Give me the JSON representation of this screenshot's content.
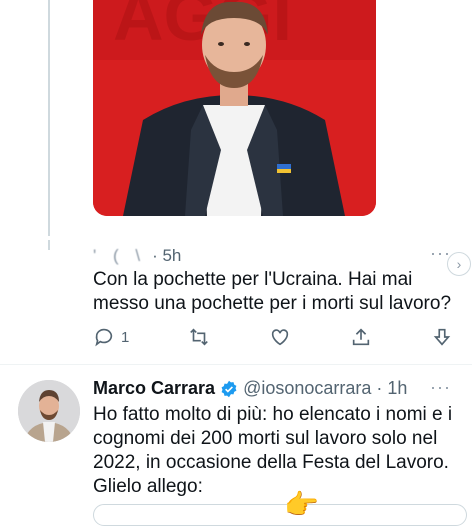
{
  "image_tweet": {
    "photo_alt": "Man in dark jacket with Ukraine pocket square"
  },
  "reply": {
    "author_blurred": "' ( \\ ",
    "time": "· 5h",
    "more": "···",
    "text": "Con la pochette per l'Ucraina. Hai mai messo una pochette per i morti sul lavoro?",
    "reply_count": "1"
  },
  "tweet": {
    "name": "Marco Carrara",
    "handle": "@iosonocarrara",
    "time": "· 1h",
    "more": "···",
    "text": "Ho fatto molto di più: ho elencato i nomi e i cognomi dei 200 morti sul lavoro solo nel 2022, in occasione della Festa del Lavoro. Glielo allego:",
    "emoji": "👉"
  },
  "colors": {
    "verified": "#1d9bf0",
    "muted": "#536471",
    "photo_bg": "#d81f20"
  }
}
